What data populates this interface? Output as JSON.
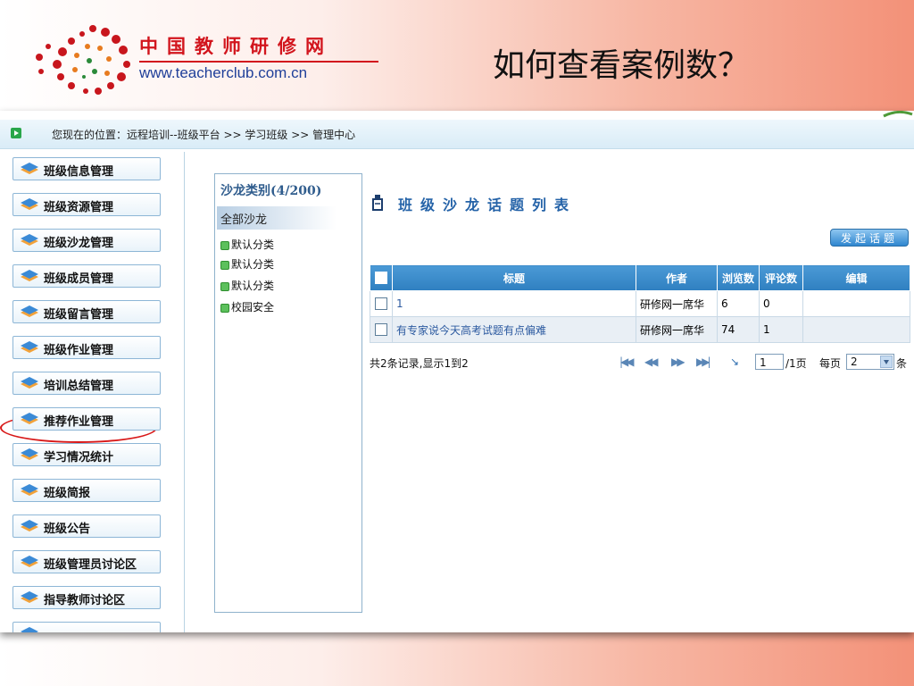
{
  "header": {
    "brand_cn": "中国教师研修网",
    "brand_url": "www.teacherclub.com.cn",
    "slide_title": "如何查看案例数？"
  },
  "breadcrumb": {
    "text": "您现在的位置：远程培训--班级平台 >> 学习班级 >> 管理中心"
  },
  "sidebar": {
    "items": [
      {
        "label": "班级信息管理"
      },
      {
        "label": "班级资源管理"
      },
      {
        "label": "班级沙龙管理"
      },
      {
        "label": "班级成员管理"
      },
      {
        "label": "班级留言管理"
      },
      {
        "label": "班级作业管理"
      },
      {
        "label": "培训总结管理"
      },
      {
        "label": "推荐作业管理"
      },
      {
        "label": "学习情况统计"
      },
      {
        "label": "班级简报"
      },
      {
        "label": "班级公告"
      },
      {
        "label": "班级管理员讨论区"
      },
      {
        "label": "指导教师讨论区"
      }
    ]
  },
  "categories": {
    "title": "沙龙类别(4/200)",
    "all_label": "全部沙龙",
    "items": [
      "默认分类",
      "默认分类",
      "默认分类",
      "校园安全"
    ]
  },
  "topic_list": {
    "title": "班级沙龙话题列表",
    "post_button": "发起话题",
    "columns": [
      "标题",
      "作者",
      "浏览数",
      "评论数",
      "编辑"
    ],
    "rows": [
      {
        "title": "1",
        "author": "研修网一席华",
        "views": "6",
        "comments": "0",
        "edit": ""
      },
      {
        "title": "有专家说今天高考试题有点偏难",
        "author": "研修网一席华",
        "views": "74",
        "comments": "1",
        "edit": ""
      }
    ]
  },
  "pager": {
    "summary": "共2条记录,显示1到2",
    "page_input": "1",
    "total_pages": "/1页",
    "per_page_label": "每页",
    "per_page_value": "2",
    "per_page_unit": "条"
  },
  "colors": {
    "brand_red": "#d2151d",
    "link_blue": "#2c5aa0",
    "header_blue": "#2f7fc0",
    "highlight_red": "#d81818"
  }
}
